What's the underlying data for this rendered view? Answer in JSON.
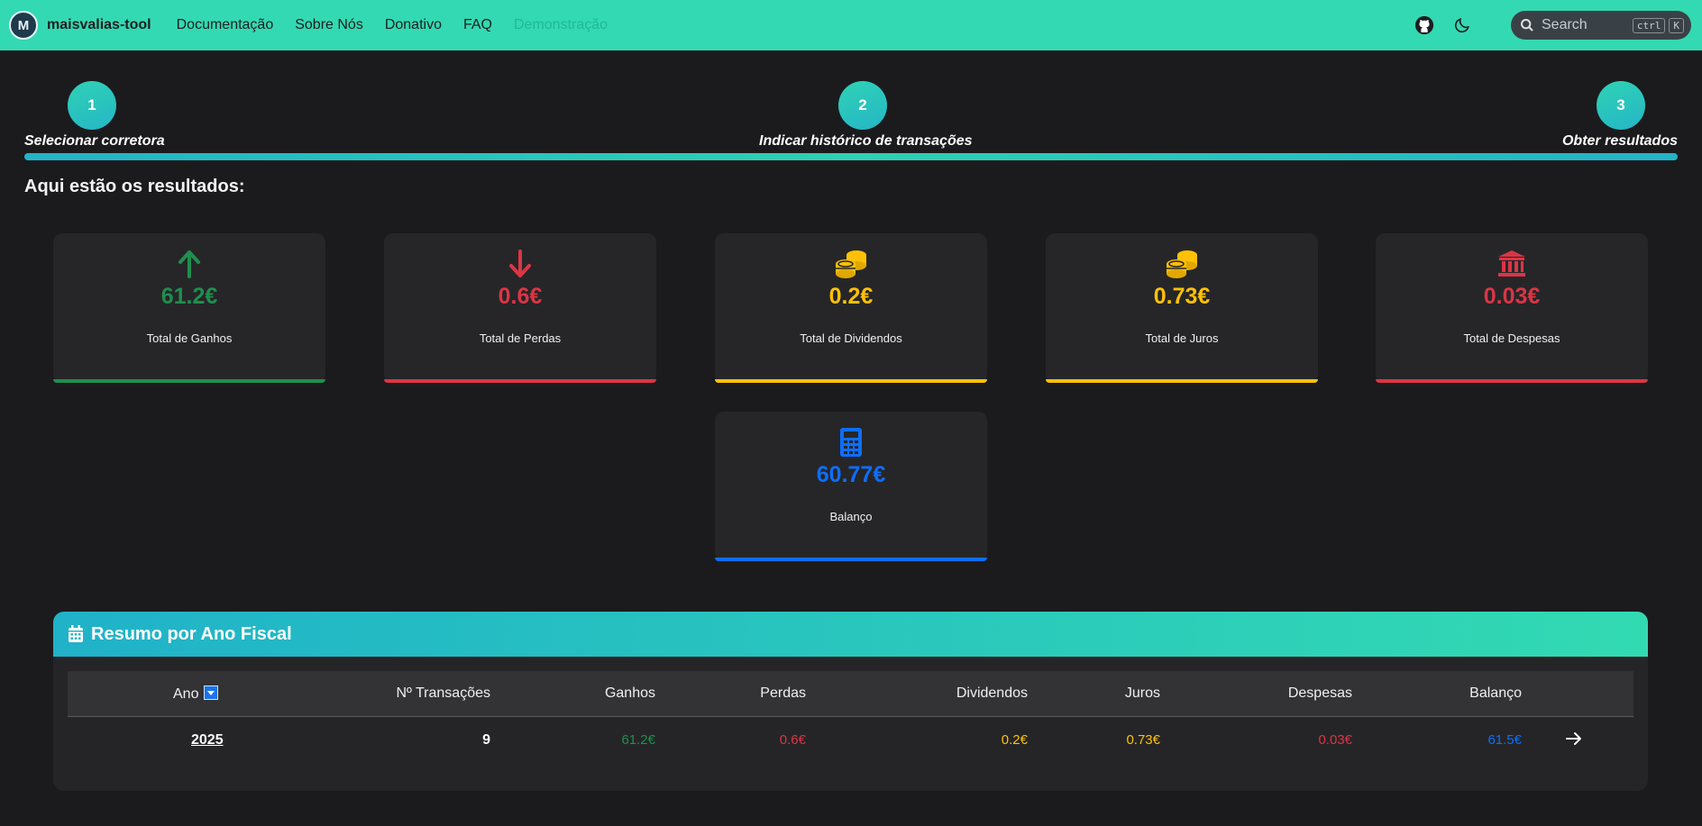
{
  "navbar": {
    "logo_text": "M",
    "brand": "maisvalias-tool",
    "links": [
      "Documentação",
      "Sobre Nós",
      "Donativo",
      "FAQ",
      "Demonstração"
    ],
    "search_placeholder": "Search",
    "shortcut_keys": [
      "ctrl",
      "K"
    ]
  },
  "stepper": {
    "steps": [
      {
        "number": "1",
        "label": "Selecionar corretora"
      },
      {
        "number": "2",
        "label": "Indicar histórico de transações"
      },
      {
        "number": "3",
        "label": "Obter resultados"
      }
    ]
  },
  "results": {
    "title": "Aqui estão os resultados:",
    "cards": [
      {
        "value": "61.2€",
        "label": "Total de Ganhos",
        "color": "#1f8f4e",
        "icon": "arrow-up-icon"
      },
      {
        "value": "0.6€",
        "label": "Total de Perdas",
        "color": "#dc3545",
        "icon": "arrow-down-icon"
      },
      {
        "value": "0.2€",
        "label": "Total de Dividendos",
        "color": "#ffc107",
        "icon": "coins-icon"
      },
      {
        "value": "0.73€",
        "label": "Total de Juros",
        "color": "#ffc107",
        "icon": "coins-icon"
      },
      {
        "value": "0.03€",
        "label": "Total de Despesas",
        "color": "#dc3545",
        "icon": "bank-icon"
      },
      {
        "value": "60.77€",
        "label": "Balanço",
        "color": "#0d6efd",
        "icon": "calculator-icon"
      }
    ]
  },
  "summary": {
    "title": "Resumo por Ano Fiscal",
    "columns": [
      "Ano",
      "Nº Transações",
      "Ganhos",
      "Perdas",
      "Dividendos",
      "Juros",
      "Despesas",
      "Balanço"
    ],
    "rows": [
      {
        "ano": "2025",
        "transacoes": "9",
        "ganhos": "61.2€",
        "perdas": "0.6€",
        "dividendos": "0.2€",
        "juros": "0.73€",
        "despesas": "0.03€",
        "balanco": "61.5€"
      }
    ],
    "colors": {
      "ganhos": "#1f8f4e",
      "perdas": "#dc3545",
      "dividendos": "#ffc107",
      "juros": "#ffc107",
      "despesas": "#dc3545",
      "balanco": "#0d6efd"
    }
  }
}
